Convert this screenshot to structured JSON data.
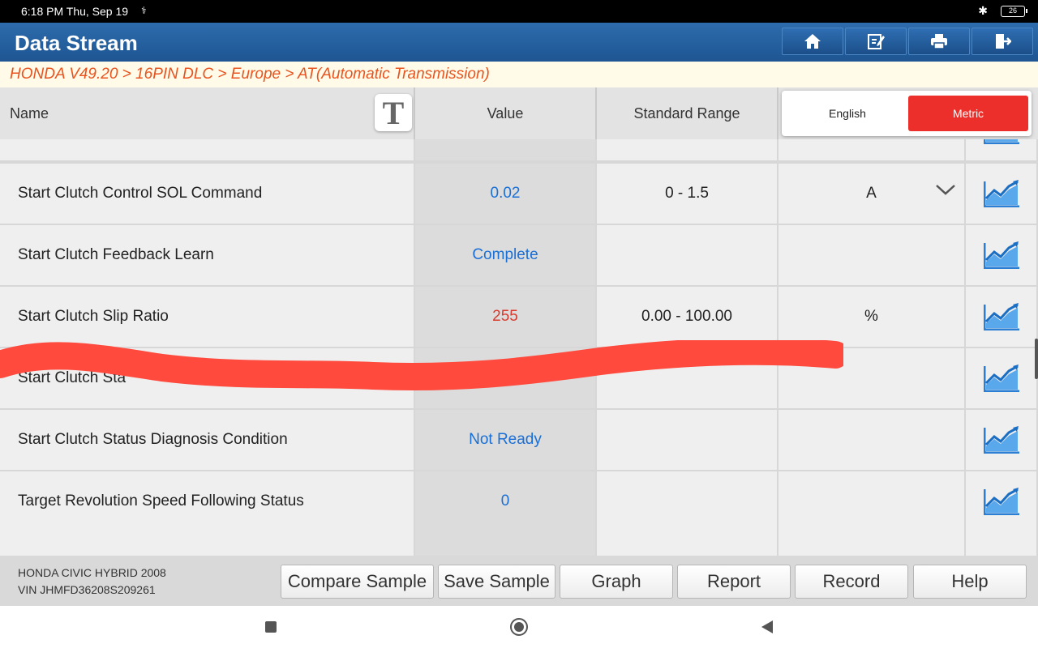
{
  "status_bar": {
    "time": "6:18 PM Thu, Sep 19",
    "battery": "26"
  },
  "header": {
    "title": "Data Stream",
    "buttons": [
      "home-icon",
      "edit-note-icon",
      "print-icon",
      "exit-icon"
    ]
  },
  "breadcrumb": "HONDA V49.20 > 16PIN DLC > Europe > AT(Automatic Transmission)",
  "table": {
    "columns": {
      "name": "Name",
      "value": "Value",
      "range": "Standard Range"
    },
    "text_size_icon": "T",
    "unit_toggle": {
      "english": "English",
      "metric": "Metric",
      "selected": "Metric"
    },
    "rows": [
      {
        "name": "Start Clutch Control SOL Command",
        "value": "0.02",
        "value_color": "#1a6fd6",
        "range": "0 - 1.5",
        "unit": "A",
        "has_dropdown": true
      },
      {
        "name": "Start Clutch Feedback Learn",
        "value": "Complete",
        "value_color": "#1a6fd6",
        "range": "",
        "unit": ""
      },
      {
        "name": "Start Clutch Slip Ratio",
        "value": "255",
        "value_color": "#d83a2e",
        "range": "0.00 - 100.00",
        "unit": "%"
      },
      {
        "name": "Start Clutch Sta",
        "value": "",
        "value_color": "#1a6fd6",
        "range": "",
        "unit": ""
      },
      {
        "name": "Start Clutch Status Diagnosis Condition",
        "value": "Not Ready",
        "value_color": "#1a6fd6",
        "range": "",
        "unit": ""
      },
      {
        "name": "Target Revolution Speed Following Status",
        "value": "0",
        "value_color": "#1a6fd6",
        "range": "",
        "unit": ""
      }
    ]
  },
  "footer": {
    "vehicle": "HONDA CIVIC HYBRID 2008",
    "vin": "VIN JHMFD36208S209261",
    "buttons": [
      "Compare Sample",
      "Save Sample",
      "Graph",
      "Report",
      "Record",
      "Help"
    ]
  },
  "colors": {
    "header": "#1e5592",
    "accent_red": "#ec2f2a",
    "value_blue": "#1a6fd6",
    "breadcrumb": "#e8531f",
    "redaction": "#ff4a3d"
  }
}
